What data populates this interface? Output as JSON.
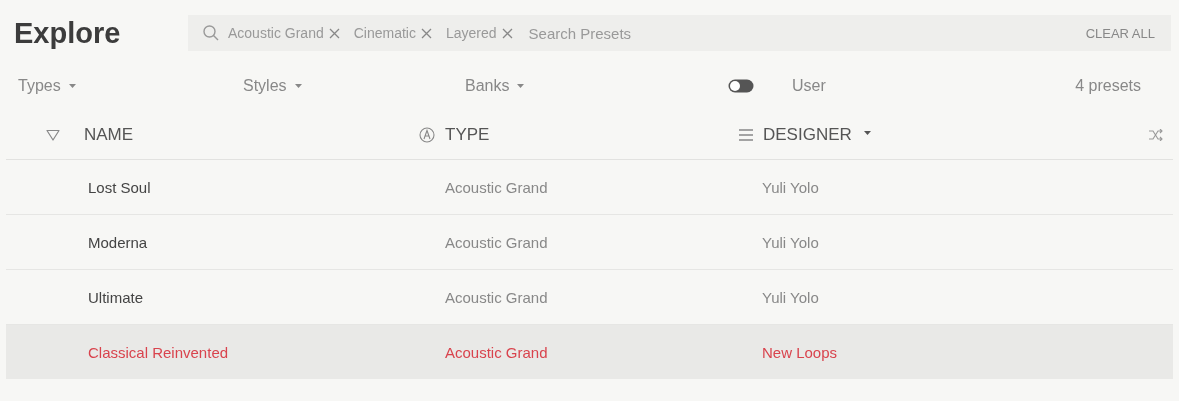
{
  "title": "Explore",
  "search": {
    "chips": [
      "Acoustic Grand",
      "Cinematic",
      "Layered"
    ],
    "placeholder": "Search Presets",
    "clear_button": "CLEAR ALL"
  },
  "filters": [
    "Types",
    "Styles",
    "Banks"
  ],
  "user_toggle": {
    "label": "User",
    "on": false
  },
  "count": "4 presets",
  "columns": [
    {
      "label": "NAME",
      "sorted": false
    },
    {
      "label": "TYPE",
      "sorted": false
    },
    {
      "label": "DESIGNER",
      "sorted": true
    }
  ],
  "rows": [
    {
      "cells": [
        "Lost Soul",
        "Acoustic Grand",
        "Yuli Yolo"
      ],
      "selected": false
    },
    {
      "cells": [
        "Moderna",
        "Acoustic Grand",
        "Yuli Yolo"
      ],
      "selected": false
    },
    {
      "cells": [
        "Ultimate",
        "Acoustic Grand",
        "Yuli Yolo"
      ],
      "selected": false
    },
    {
      "cells": [
        "Classical Reinvented",
        "Acoustic Grand",
        "New Loops"
      ],
      "selected": true
    }
  ]
}
